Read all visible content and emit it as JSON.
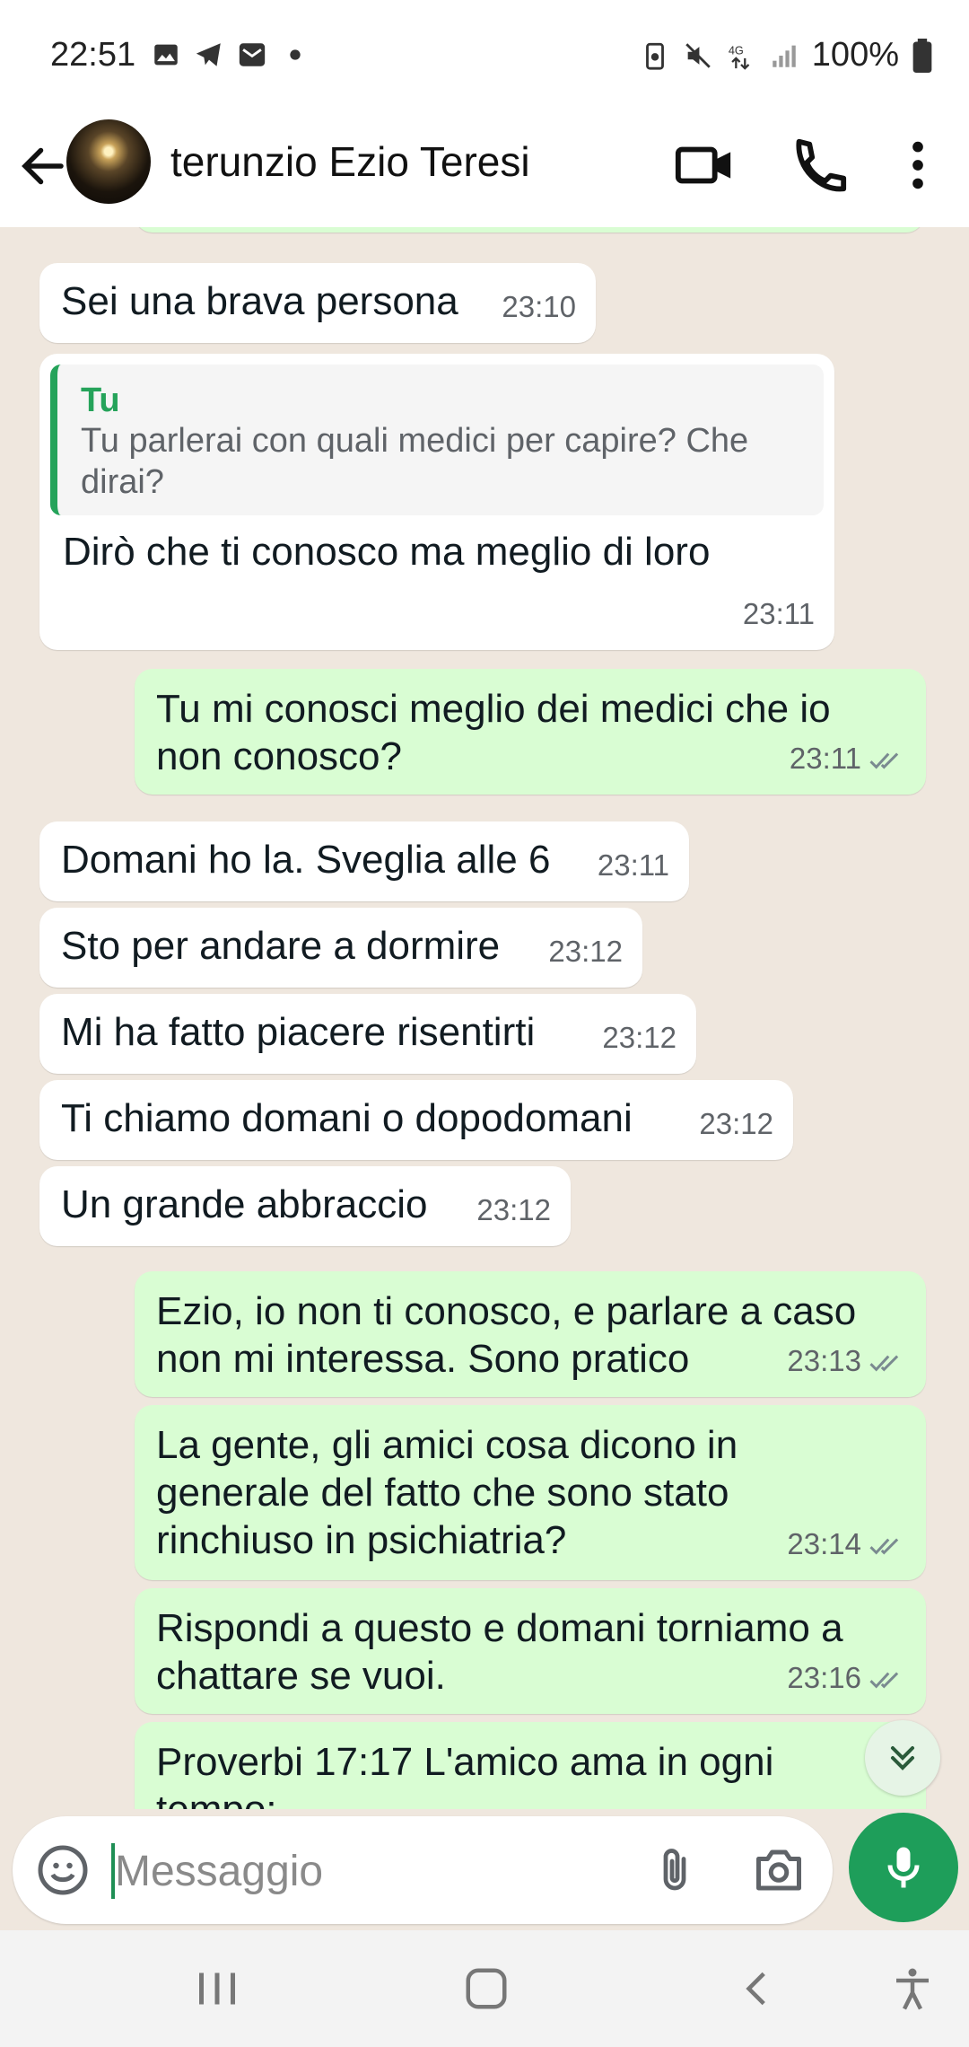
{
  "status_bar": {
    "time": "22:51",
    "notification_icons": [
      "gallery-icon",
      "telegram-icon",
      "mail-icon",
      "dot-icon"
    ],
    "system_icons": [
      "battery-saver-icon",
      "mute-icon",
      "4g-data-icon",
      "signal-icon"
    ],
    "battery": "100%"
  },
  "header": {
    "contact_name": "terunzio Ezio Teresi",
    "icons": [
      "back-arrow-icon",
      "video-call-icon",
      "phone-icon",
      "more-options-icon"
    ]
  },
  "messages": [
    {
      "dir": "in",
      "text": "Sei una brava persona",
      "time": "23:10"
    },
    {
      "dir": "in",
      "quote_author": "Tu",
      "quote_text": "Tu parlerai con quali medici per capire? Che dirai?",
      "text": "Dirò che ti conosco ma meglio di loro",
      "time": "23:11"
    },
    {
      "dir": "out",
      "line1": "Tu mi conosci meglio dei medici che io",
      "line2": "non conosco?",
      "time": "23:11"
    },
    {
      "dir": "in",
      "text": "Domani ho la. Sveglia alle 6",
      "time": "23:11"
    },
    {
      "dir": "in",
      "text": "Sto per andare a dormire",
      "time": "23:12"
    },
    {
      "dir": "in",
      "text": "Mi ha fatto piacere risentirti",
      "time": "23:12"
    },
    {
      "dir": "in",
      "text": "Ti chiamo domani o dopodomani",
      "time": "23:12"
    },
    {
      "dir": "in",
      "text": "Un grande abbraccio",
      "time": "23:12"
    },
    {
      "dir": "out",
      "line1": "Ezio, io non ti conosco, e parlare a caso",
      "line2": "non mi interessa. Sono pratico",
      "time": "23:13"
    },
    {
      "dir": "out",
      "line1": "La gente, gli amici cosa dicono in",
      "line2": "generale del fatto che sono stato",
      "line3": "rinchiuso in psichiatria?",
      "time": "23:14"
    },
    {
      "dir": "out",
      "line1": "Rispondi a questo e domani torniamo a",
      "line2": "chattare se vuoi.",
      "time": "23:16"
    },
    {
      "dir": "out",
      "line1": "Proverbi 17:17  L'amico ama in ogni",
      "line2": "tempo;"
    }
  ],
  "input": {
    "placeholder": "Messaggio"
  },
  "colors": {
    "incoming": "#ffffff",
    "outgoing": "#d9fdd3",
    "accent": "#1e9e5a",
    "chat_bg": "#efe7de"
  }
}
